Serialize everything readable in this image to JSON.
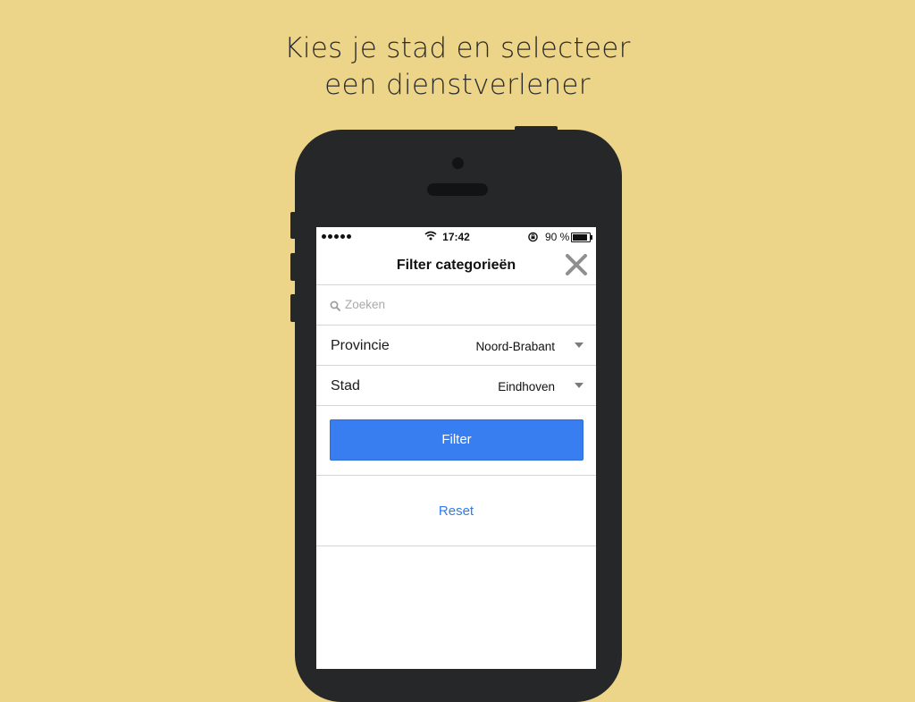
{
  "headline": {
    "line1": "Kies je stad en selecteer",
    "line2": "een dienstverlener"
  },
  "status_bar": {
    "time": "17:42",
    "battery_percent": "90 %",
    "battery_level": 0.9,
    "icons": [
      "signal-dots-icon",
      "wifi-icon",
      "rotation-lock-icon",
      "battery-icon"
    ]
  },
  "nav": {
    "title": "Filter categorieën",
    "close_icon": "close-icon"
  },
  "search": {
    "placeholder": "Zoeken",
    "value": "",
    "icon": "search-icon"
  },
  "filters": [
    {
      "label": "Provincie",
      "value": "Noord-Brabant"
    },
    {
      "label": "Stad",
      "value": "Eindhoven"
    }
  ],
  "actions": {
    "filter_label": "Filter",
    "reset_label": "Reset"
  },
  "colors": {
    "background": "#ecd488",
    "phone": "#252728",
    "primary_button": "#397ef0",
    "link": "#2f7cec"
  }
}
